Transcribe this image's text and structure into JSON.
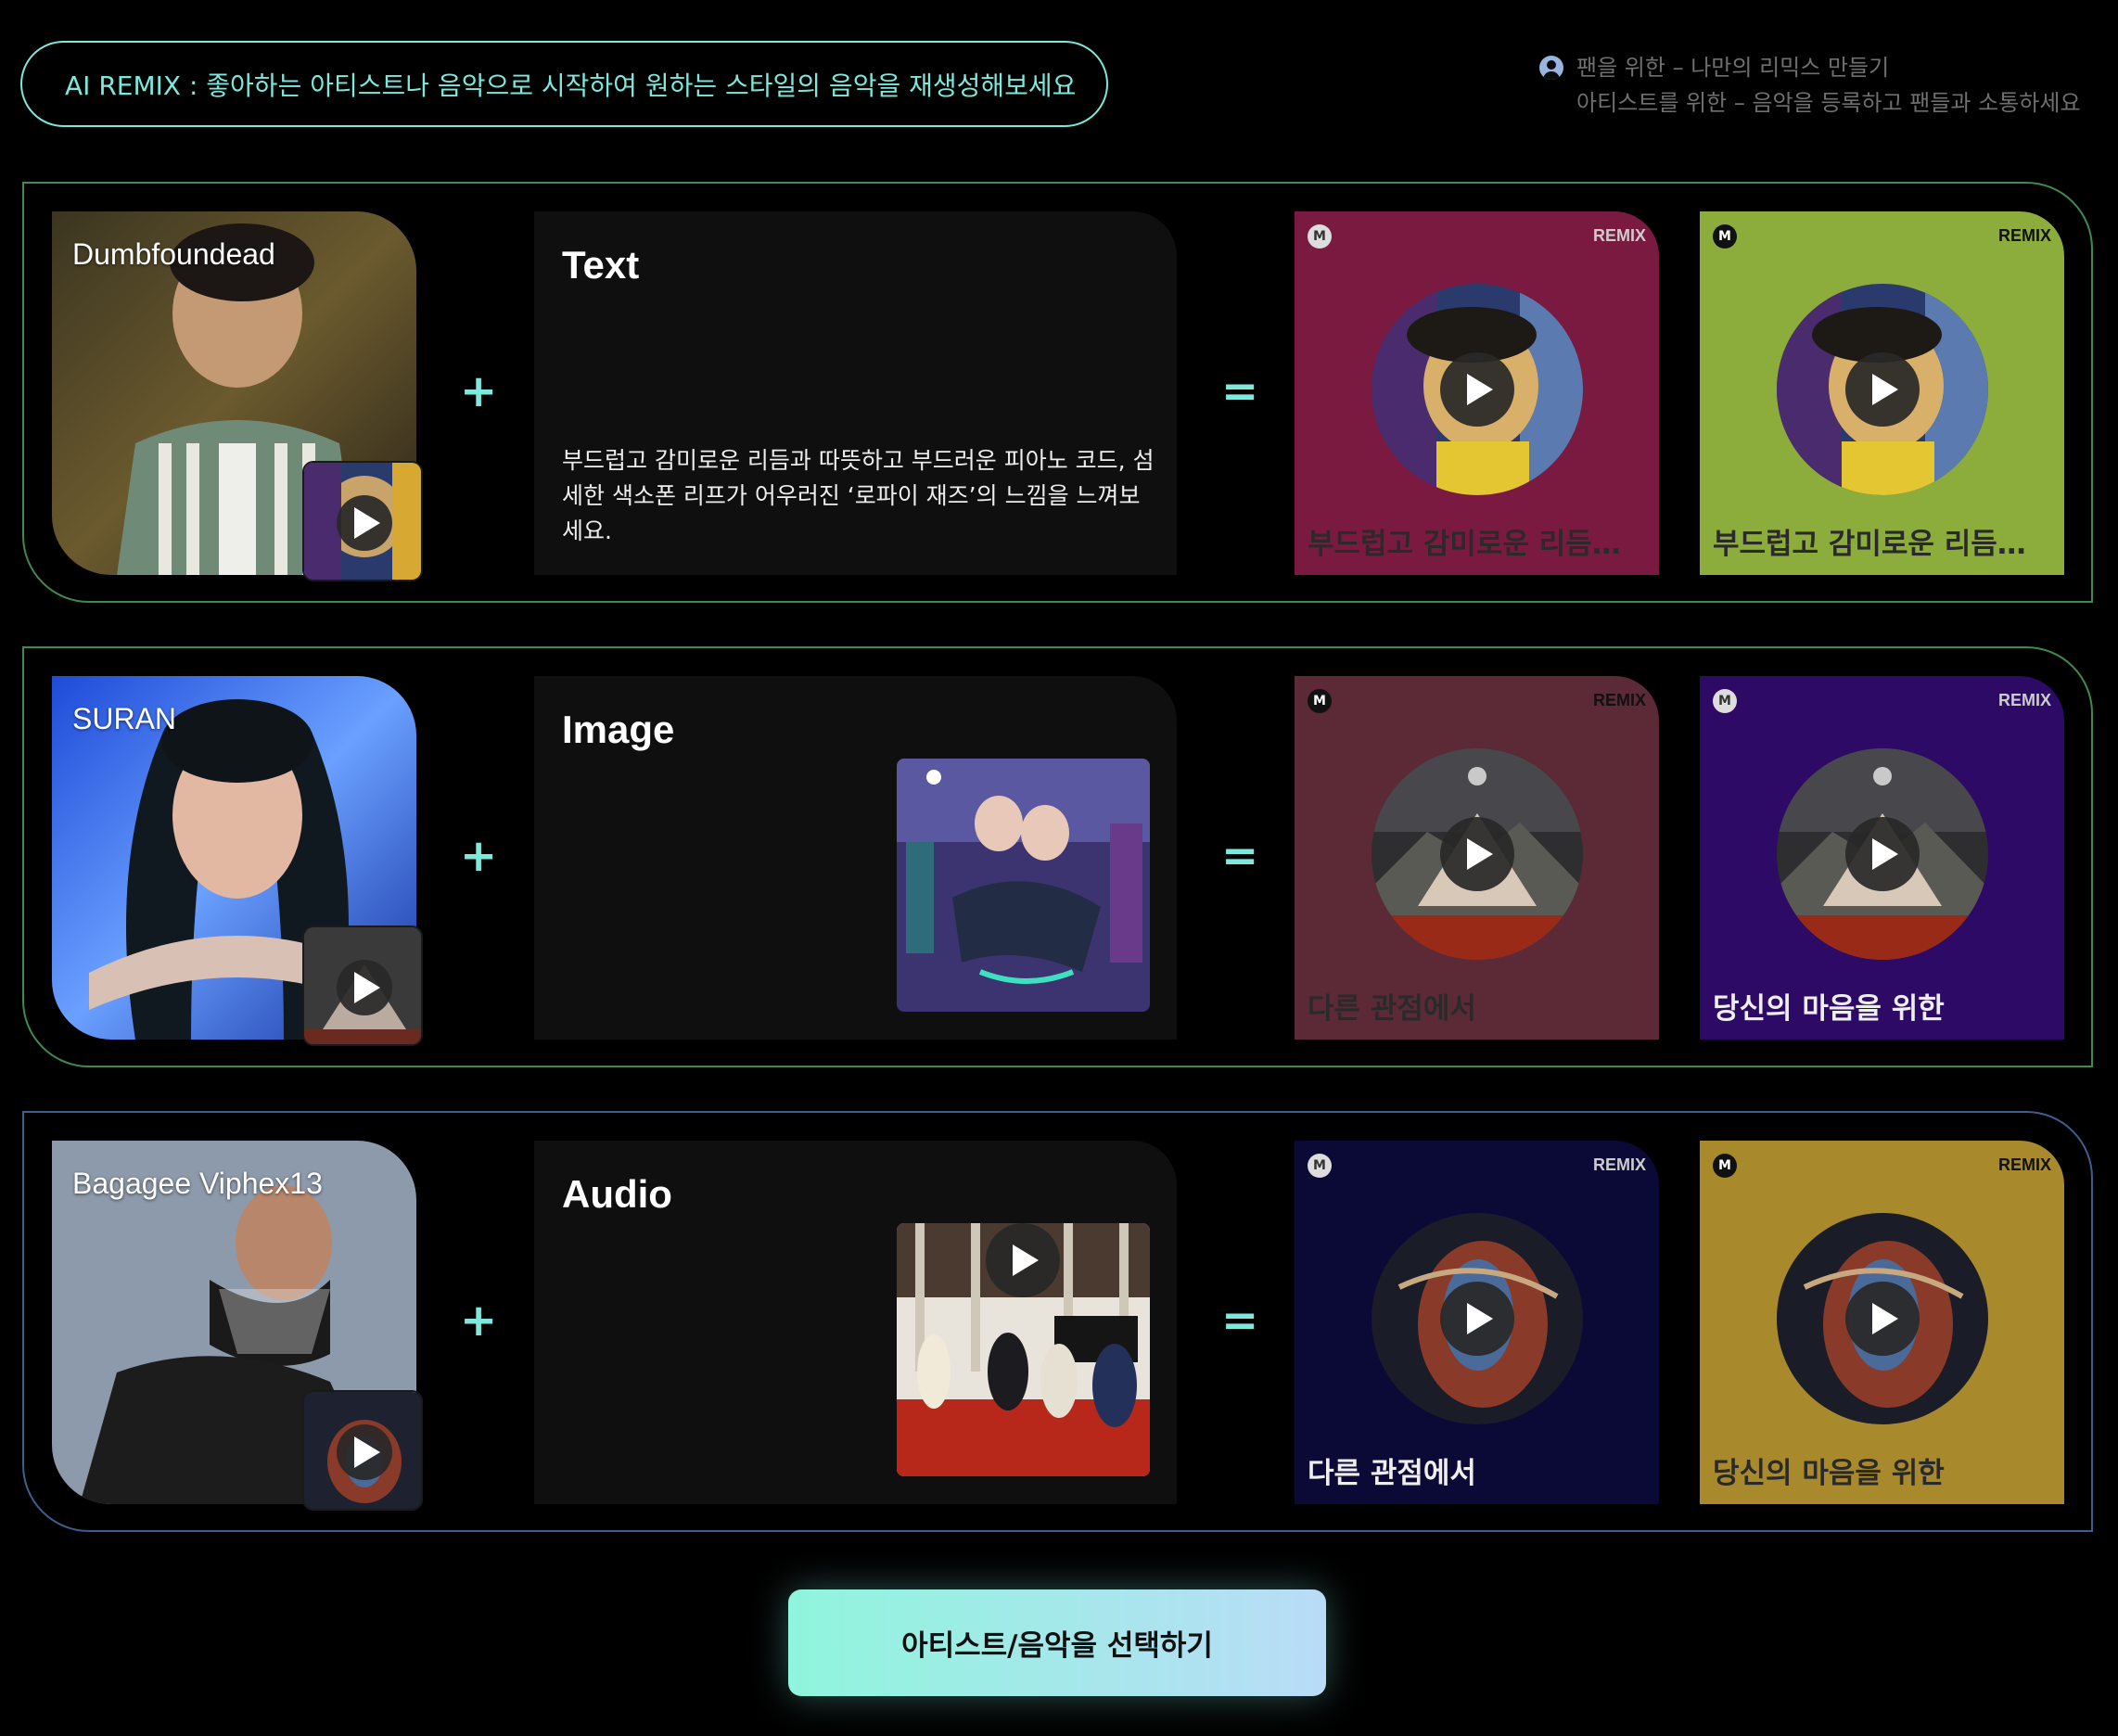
{
  "header": {
    "banner": "AI REMIX : 좋아하는 아티스트나 음악으로 시작하여 원하는 스타일의 음악을 재생성해보세요",
    "info_line1": "팬을 위한 – 나만의 리믹스 만들기",
    "info_line2": "아티스트를 위한 – 음악을 등록하고 팬들과 소통하세요"
  },
  "operators": {
    "plus": "+",
    "equals": "="
  },
  "rows": [
    {
      "artist": "Dumbfoundead",
      "input_type": "Text",
      "input_text": "부드럽고 감미로운 리듬과 따뜻하고 부드러운 피아노 코드, 섬세한 색소폰 리프가 어우러진 ‘로파이 재즈’의 느낌을 느껴보세요.",
      "remixes": [
        {
          "tag": "REMIX",
          "logo": "M",
          "title": "부드럽고 감미로운 리듬과 따뜻하고",
          "color": "#7a1a40"
        },
        {
          "tag": "REMIX",
          "logo": "M",
          "title": "부드럽고 감미로운 리듬과 따뜻하고",
          "color": "#8cac3c"
        }
      ]
    },
    {
      "artist": "SURAN",
      "input_type": "Image",
      "remixes": [
        {
          "tag": "REMIX",
          "logo": "M",
          "title": "다른 관점에서",
          "color": "#5c2a36"
        },
        {
          "tag": "REMIX",
          "logo": "M",
          "title": "당신의 마음을 위한",
          "color": "#2c0a66"
        }
      ]
    },
    {
      "artist": "Bagagee Viphex13",
      "input_type": "Audio",
      "remixes": [
        {
          "tag": "REMIX",
          "logo": "M",
          "title": "다른 관점에서",
          "color": "#0b0a36"
        },
        {
          "tag": "REMIX",
          "logo": "M",
          "title": "당신의 마음을 위한",
          "color": "#a88a2c"
        }
      ]
    }
  ],
  "cta": {
    "label": "아티스트/음악을 선택하기"
  },
  "icons": {
    "user": "user-circle-icon",
    "play": "play-icon",
    "logo": "m-logo-icon"
  },
  "colors": {
    "accent": "#7ee8dc",
    "row_border_green": "#3f8a4f",
    "row_border_blue": "#3c5f8f",
    "cta_gradient_start": "#8ff5dc",
    "cta_gradient_end": "#b9dcf7"
  }
}
